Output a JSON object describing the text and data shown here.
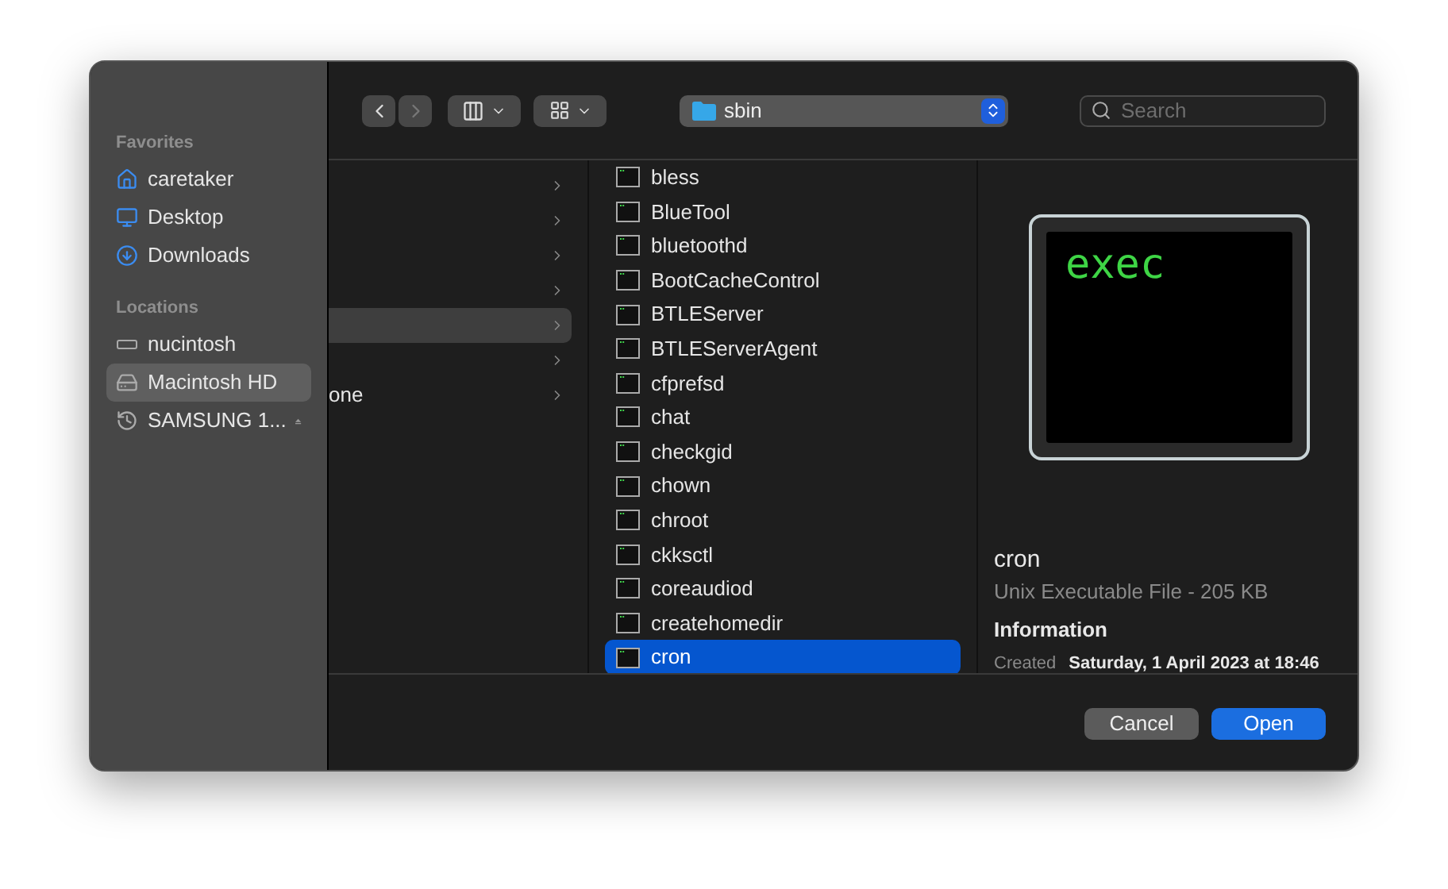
{
  "sidebar": {
    "sections": [
      {
        "title": "Favorites",
        "items": [
          {
            "label": "caretaker",
            "kind": "home",
            "selected": false,
            "ejectable": false
          },
          {
            "label": "Desktop",
            "kind": "desktop",
            "selected": false,
            "ejectable": false
          },
          {
            "label": "Downloads",
            "kind": "downloads",
            "selected": false,
            "ejectable": false
          }
        ]
      },
      {
        "title": "Locations",
        "items": [
          {
            "label": "nucintosh",
            "kind": "network",
            "selected": false,
            "ejectable": false
          },
          {
            "label": "Macintosh HD",
            "kind": "disk",
            "selected": true,
            "ejectable": false
          },
          {
            "label": "SAMSUNG 1...",
            "kind": "backup",
            "selected": false,
            "ejectable": true
          }
        ]
      }
    ]
  },
  "toolbar": {
    "back_enabled": true,
    "forward_enabled": false,
    "path": "sbin",
    "search": {
      "placeholder": "Search"
    }
  },
  "column_1": {
    "rows": [
      {
        "selected": false
      },
      {
        "selected": false
      },
      {
        "selected": false
      },
      {
        "selected": false
      },
      {
        "selected": true
      },
      {
        "selected": false
      },
      {
        "label": "one",
        "selected": false
      }
    ]
  },
  "column_2": {
    "rows": [
      {
        "label": "bless",
        "selected": false
      },
      {
        "label": "BlueTool",
        "selected": false
      },
      {
        "label": "bluetoothd",
        "selected": false
      },
      {
        "label": "BootCacheControl",
        "selected": false
      },
      {
        "label": "BTLEServer",
        "selected": false
      },
      {
        "label": "BTLEServerAgent",
        "selected": false
      },
      {
        "label": "cfprefsd",
        "selected": false
      },
      {
        "label": "chat",
        "selected": false
      },
      {
        "label": "checkgid",
        "selected": false
      },
      {
        "label": "chown",
        "selected": false
      },
      {
        "label": "chroot",
        "selected": false
      },
      {
        "label": "ckksctl",
        "selected": false
      },
      {
        "label": "coreaudiod",
        "selected": false
      },
      {
        "label": "createhomedir",
        "selected": false
      },
      {
        "label": "cron",
        "selected": true
      }
    ]
  },
  "preview": {
    "icon_text": "exec",
    "name": "cron",
    "kind": "Unix Executable File - 205 KB",
    "section": "Information",
    "fields": [
      {
        "label": "Created",
        "value": "Saturday, 1 April 2023 at 18:46"
      }
    ]
  },
  "buttons": [
    {
      "label": "Cancel",
      "kind": "secondary"
    },
    {
      "label": "Open",
      "kind": "primary"
    }
  ]
}
